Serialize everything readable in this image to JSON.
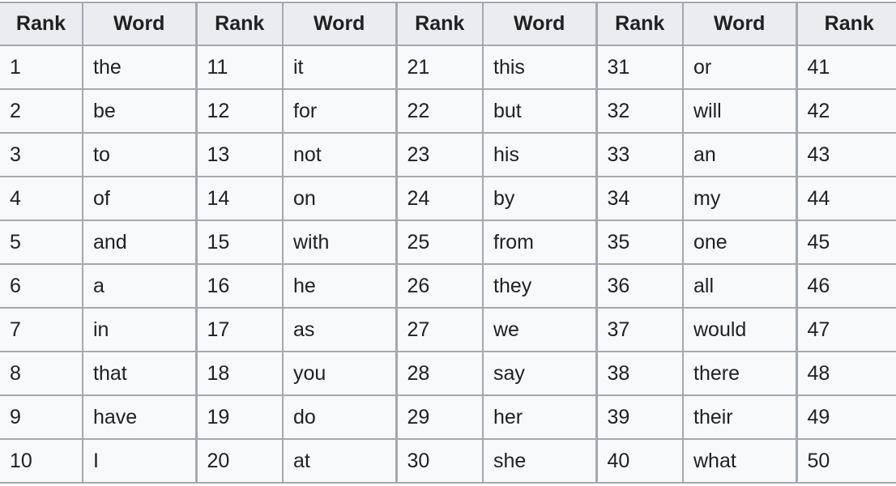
{
  "table": {
    "headers": [
      "Rank",
      "Word",
      "Rank",
      "Word",
      "Rank",
      "Word",
      "Rank",
      "Word",
      "Rank"
    ],
    "rows": [
      [
        "1",
        "the",
        "11",
        "it",
        "21",
        "this",
        "31",
        "or",
        "41"
      ],
      [
        "2",
        "be",
        "12",
        "for",
        "22",
        "but",
        "32",
        "will",
        "42"
      ],
      [
        "3",
        "to",
        "13",
        "not",
        "23",
        "his",
        "33",
        "an",
        "43"
      ],
      [
        "4",
        "of",
        "14",
        "on",
        "24",
        "by",
        "34",
        "my",
        "44"
      ],
      [
        "5",
        "and",
        "15",
        "with",
        "25",
        "from",
        "35",
        "one",
        "45"
      ],
      [
        "6",
        "a",
        "16",
        "he",
        "26",
        "they",
        "36",
        "all",
        "46"
      ],
      [
        "7",
        "in",
        "17",
        "as",
        "27",
        "we",
        "37",
        "would",
        "47"
      ],
      [
        "8",
        "that",
        "18",
        "you",
        "28",
        "say",
        "38",
        "there",
        "48"
      ],
      [
        "9",
        "have",
        "19",
        "do",
        "29",
        "her",
        "39",
        "their",
        "49"
      ],
      [
        "10",
        "I",
        "20",
        "at",
        "30",
        "she",
        "40",
        "what",
        "50"
      ]
    ]
  },
  "colors": {
    "header_bg": "#eaecf0",
    "cell_bg": "#f8f9fa",
    "border": "#a2a9b1",
    "text": "#202122"
  }
}
